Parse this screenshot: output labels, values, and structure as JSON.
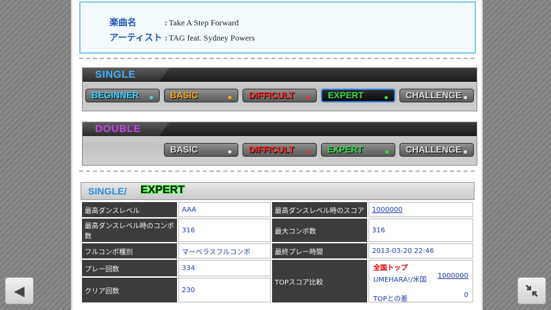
{
  "song": {
    "title_label": "楽曲名",
    "title_value": "Take A Step Forward",
    "artist_label": "アーティスト",
    "artist_value": "TAG feat. Sydney Powers"
  },
  "single_panel": {
    "title": "SINGLE",
    "difficulties": [
      {
        "label": "BEGINNER",
        "color": "#3fd6ff",
        "selected": false
      },
      {
        "label": "BASIC",
        "color": "#ffb020",
        "selected": false
      },
      {
        "label": "DIFFICULT",
        "color": "#ff2a2a",
        "selected": false
      },
      {
        "label": "EXPERT",
        "color": "#35e04a",
        "selected": true
      },
      {
        "label": "CHALLENGE",
        "color": "#e0e0e0",
        "selected": false
      }
    ]
  },
  "double_panel": {
    "title": "DOUBLE",
    "difficulties": [
      {
        "label": "BASIC",
        "color": "#e0e0e0"
      },
      {
        "label": "DIFFICULT",
        "color": "#ff2a2a"
      },
      {
        "label": "EXPERT",
        "color": "#35e04a"
      },
      {
        "label": "CHALLENGE",
        "color": "#e0e0e0"
      }
    ]
  },
  "detail": {
    "mode": "SINGLE/",
    "difficulty": "EXPERT",
    "rows": [
      {
        "k1": "最高ダンスレベル",
        "v1": "AAA",
        "k2": "最高ダンスレベル時のスコア",
        "v2": "1000000"
      },
      {
        "k1": "最高ダンスレベル時のコンボ数",
        "v1": "316",
        "k2": "最大コンボ数",
        "v2": "316"
      },
      {
        "k1": "フルコンボ種別",
        "v1": "マーベラスフルコンボ",
        "k2": "最終プレー時間",
        "v2": "2013-03-20 22:46"
      }
    ],
    "play_count_label": "プレー回数",
    "play_count": "334",
    "clear_count_label": "クリア回数",
    "clear_count": "230",
    "top_label": "TOPスコア比較",
    "top_national": "全国トップ",
    "top_player": "UMEHARA!/米国",
    "top_score": "1000000",
    "top_diff_label": "TOPとの差",
    "top_diff": "0"
  },
  "icons": {
    "back": "back-arrow-icon",
    "collapse": "collapse-icon",
    "foot": "footprint-icon"
  }
}
